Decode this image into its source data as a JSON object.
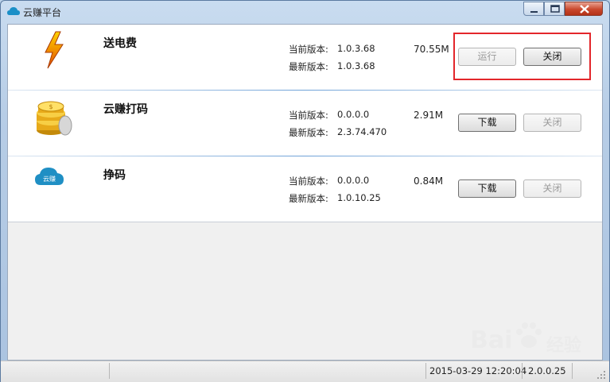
{
  "window": {
    "title": "云赚平台",
    "icon": "cloud-icon"
  },
  "controls": {
    "minimize": "minimize-icon",
    "maximize": "maximize-icon",
    "close": "close-icon"
  },
  "labels": {
    "current": "当前版本:",
    "latest": "最新版本:"
  },
  "apps": [
    {
      "name": "送电费",
      "icon": "lightning-icon",
      "current": "1.0.3.68",
      "latest": "1.0.3.68",
      "size": "70.55M",
      "primary": {
        "label": "运行",
        "enabled": false
      },
      "secondary": {
        "label": "关闭",
        "enabled": true
      }
    },
    {
      "name": "云赚打码",
      "icon": "gold-coins-icon",
      "current": "0.0.0.0",
      "latest": "2.3.74.470",
      "size": "2.91M",
      "primary": {
        "label": "下载",
        "enabled": true
      },
      "secondary": {
        "label": "关闭",
        "enabled": false
      }
    },
    {
      "name": "挣码",
      "icon": "cloud-logo-icon",
      "icon_text": "云赚",
      "current": "0.0.0.0",
      "latest": "1.0.10.25",
      "size": "0.84M",
      "primary": {
        "label": "下载",
        "enabled": true
      },
      "secondary": {
        "label": "关闭",
        "enabled": false
      }
    }
  ],
  "status": {
    "datetime": "2015-03-29 12:20:04",
    "version": "2.0.0.25"
  },
  "watermark": {
    "text": "Bai",
    "text2": "经验",
    "icon": "paw-icon"
  },
  "colors": {
    "highlight": "#e3262b",
    "accent": "#1a8fc7"
  }
}
